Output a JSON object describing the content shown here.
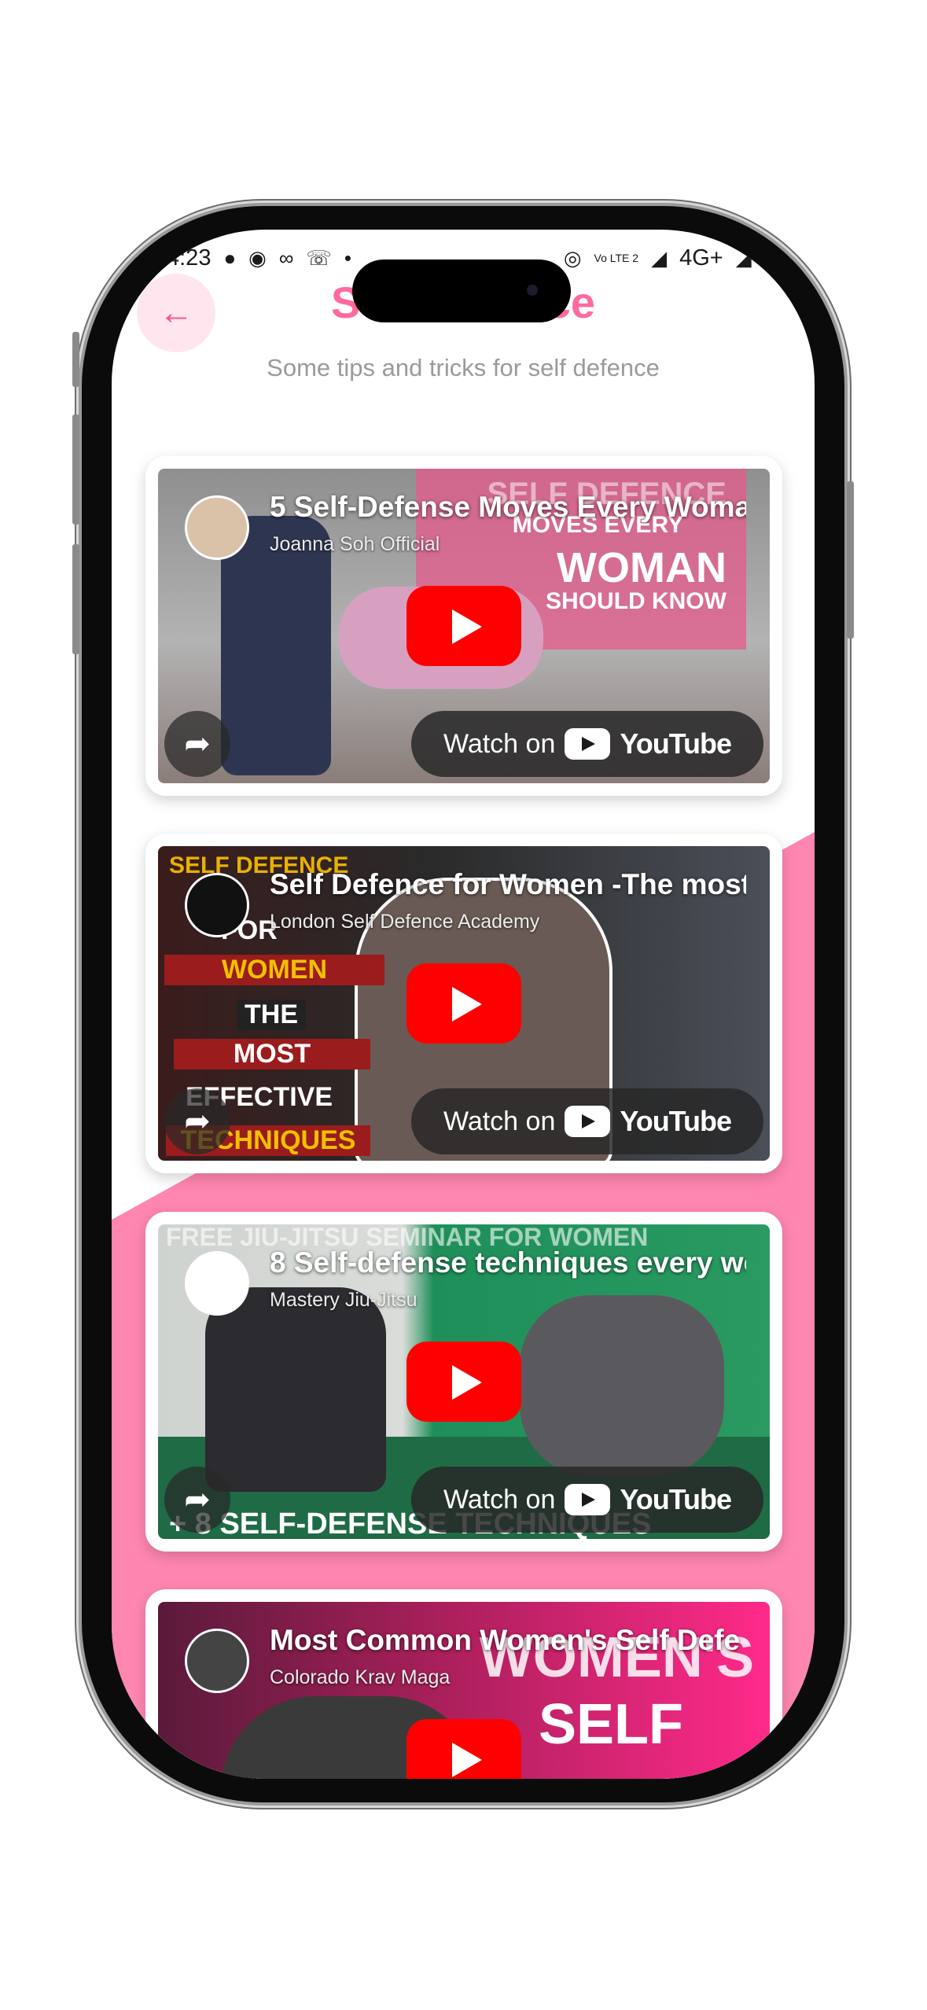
{
  "status_bar": {
    "time": "4:23",
    "left_icons": [
      "chat-icon",
      "messenger-icon",
      "voicemail-icon",
      "whatsapp-icon"
    ],
    "network": "4G+",
    "volte": "Vo LTE 2"
  },
  "header": {
    "title": "Self Defence",
    "subtitle": "Some tips and tricks for self defence"
  },
  "colors": {
    "accent": "#ff69a0",
    "pink_background": "#ff86b1",
    "youtube_red": "#ff0000"
  },
  "watch_on_label": "Watch on",
  "youtube_label": "YouTube",
  "videos": [
    {
      "title": "5 Self-Defense Moves Every Woma",
      "channel": "Joanna Soh Official",
      "overlay_lines": [
        "SELF DEFENCE",
        "MOVES EVERY",
        "WOMAN",
        "SHOULD KNOW"
      ]
    },
    {
      "title": "Self Defence for Women -The most",
      "channel": "London Self Defence Academy",
      "overlay_lines": [
        "SELF DEFENCE",
        "FOR",
        "WOMEN",
        "THE",
        "MOST",
        "EFFECTIVE",
        "TECHNIQUES"
      ]
    },
    {
      "title": "8 Self-defense techniques every wo",
      "channel": "Mastery Jiu-Jitsu",
      "overlay_lines": [
        "FREE JIU-JITSU SEMINAR FOR WOMEN",
        "+ 8 SELF-DEFENSE TECHNIQUES"
      ]
    },
    {
      "title": "Most Common Women's Self Defe",
      "channel": "Colorado Krav Maga",
      "overlay_lines": [
        "WOMEN'S",
        "SELF"
      ]
    }
  ]
}
